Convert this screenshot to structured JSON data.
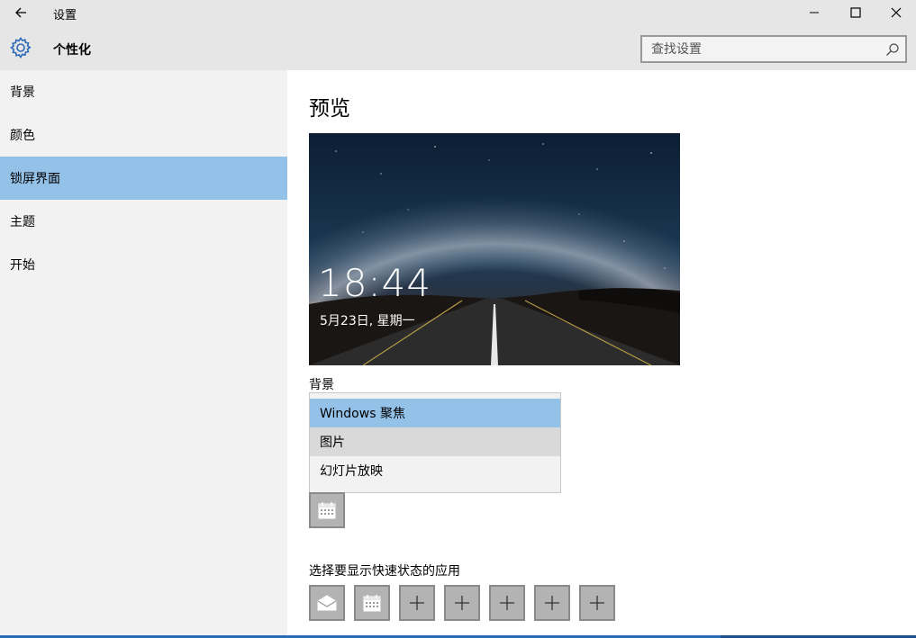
{
  "window": {
    "title": "设置",
    "back_icon": "arrow-left-icon",
    "controls": [
      "minimize-icon",
      "maximize-icon",
      "close-icon"
    ]
  },
  "header": {
    "title": "个性化",
    "icon": "gear-icon",
    "search": {
      "placeholder": "查找设置",
      "value": "",
      "icon": "search-icon"
    }
  },
  "sidebar": {
    "items": [
      {
        "label": "背景",
        "active": false
      },
      {
        "label": "颜色",
        "active": false
      },
      {
        "label": "锁屏界面",
        "active": true
      },
      {
        "label": "主题",
        "active": false
      },
      {
        "label": "开始",
        "active": false
      }
    ]
  },
  "main": {
    "heading": "预览",
    "preview": {
      "time": "18:44",
      "date": "5月23日, 星期一"
    },
    "background_label": "背景",
    "background_options": [
      {
        "label": "Windows 聚焦",
        "state": "selected"
      },
      {
        "label": "图片",
        "state": "hover"
      },
      {
        "label": "幻灯片放映",
        "state": "normal"
      }
    ],
    "detailed_status_app_icon": "calendar-icon",
    "quick_status_label": "选择要显示快速状态的应用",
    "quick_status_apps": [
      "mail-icon",
      "calendar-icon",
      "plus-icon",
      "plus-icon",
      "plus-icon",
      "plus-icon",
      "plus-icon"
    ]
  },
  "colors": {
    "accent_selected": "#94c1e8",
    "sidebar_bg": "#f2f2f2",
    "titlebar_bg": "#e6e6e6",
    "tile_bg": "#b3b3b3"
  }
}
